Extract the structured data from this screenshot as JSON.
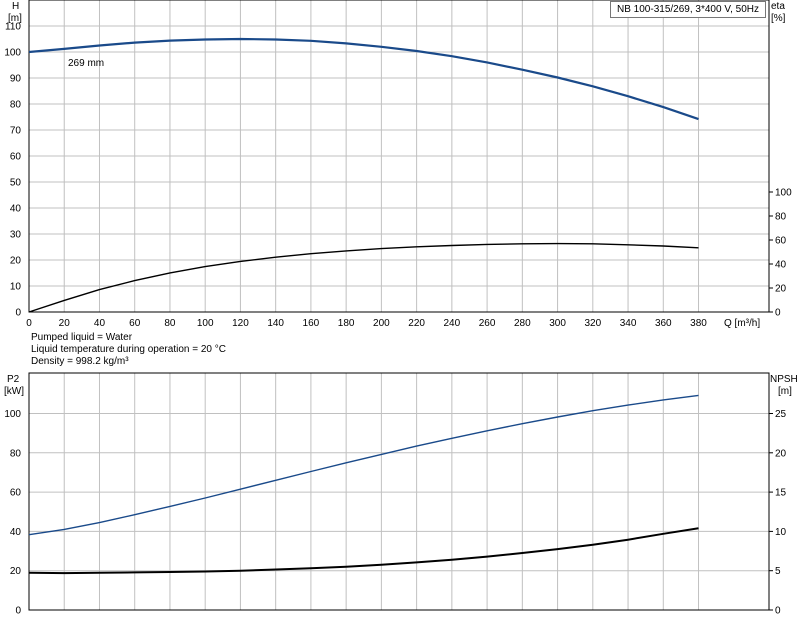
{
  "pump_label": "NB 100-315/269, 3*400 V, 50Hz",
  "liquid_info": {
    "line1": "Pumped liquid = Water",
    "line2": "Liquid temperature during operation = 20 °C",
    "line3": "Density = 998.2 kg/m³"
  },
  "colors": {
    "head": "#1a4a8a",
    "eta": "#000000",
    "p2": "#1a4a8a",
    "npsh": "#000000",
    "grid": "#c0c0c0"
  },
  "chart_data": [
    {
      "type": "line",
      "title": "",
      "x_axis": {
        "label": "Q [m³/h]",
        "range": [
          0,
          420
        ],
        "ticks": [
          0,
          20,
          40,
          60,
          80,
          100,
          120,
          140,
          160,
          180,
          200,
          220,
          240,
          260,
          280,
          300,
          320,
          340,
          360,
          380
        ]
      },
      "y_left": {
        "label_line1": "H",
        "label_line2": "[m]",
        "range": [
          0,
          120
        ],
        "ticks": [
          0,
          10,
          20,
          30,
          40,
          50,
          60,
          70,
          80,
          90,
          100,
          110
        ]
      },
      "y_right": {
        "label_line1": "eta",
        "label_line2": "[%]",
        "range": [
          0,
          100
        ],
        "ticks": [
          0,
          20,
          40,
          60,
          80,
          100
        ]
      },
      "grid": true,
      "series": [
        {
          "name": "269 mm",
          "axis": "left",
          "x": [
            0,
            20,
            40,
            60,
            80,
            100,
            120,
            140,
            160,
            180,
            200,
            220,
            240,
            260,
            280,
            300,
            320,
            340,
            360,
            380
          ],
          "y": [
            100,
            101.2,
            102.5,
            103.6,
            104.4,
            104.8,
            105,
            104.8,
            104.3,
            103.3,
            102,
            100.4,
            98.4,
            96,
            93.2,
            90.2,
            86.8,
            83,
            78.8,
            74.2
          ]
        },
        {
          "axis": "right",
          "x": [
            0,
            20,
            40,
            60,
            80,
            100,
            120,
            140,
            160,
            180,
            200,
            220,
            240,
            260,
            280,
            300,
            320,
            340,
            360,
            380
          ],
          "y": [
            0,
            9.7,
            18.7,
            26.2,
            32.6,
            37.8,
            42.2,
            45.7,
            48.6,
            50.9,
            52.8,
            54.3,
            55.4,
            56.3,
            56.8,
            57.0,
            56.8,
            56.0,
            55.0,
            53.5
          ]
        }
      ]
    },
    {
      "type": "line",
      "title": "",
      "x_axis": {
        "range": [
          0,
          420
        ]
      },
      "y_left": {
        "label_line1": "P2",
        "label_line2": "[kW]",
        "range": [
          0,
          120
        ],
        "ticks": [
          0,
          20,
          40,
          60,
          80,
          100
        ]
      },
      "y_right": {
        "label_line1": "NPSH",
        "label_line2": "[m]",
        "range": [
          0,
          30
        ],
        "ticks": [
          0,
          5,
          10,
          15,
          20,
          25
        ]
      },
      "grid": true,
      "series": [
        {
          "axis": "left",
          "x": [
            0,
            20,
            40,
            60,
            80,
            100,
            120,
            140,
            160,
            180,
            200,
            220,
            240,
            260,
            280,
            300,
            320,
            340,
            360,
            380
          ],
          "y": [
            38.3,
            41,
            44.5,
            48.5,
            52.7,
            57,
            61.5,
            66,
            70.5,
            74.9,
            79.2,
            83.4,
            87.4,
            91.2,
            94.8,
            98.2,
            101.4,
            104.3,
            106.9,
            109.2
          ]
        },
        {
          "axis": "right",
          "x": [
            0,
            20,
            40,
            60,
            80,
            100,
            120,
            140,
            160,
            180,
            200,
            220,
            240,
            260,
            280,
            300,
            320,
            340,
            360,
            380
          ],
          "y": [
            4.75,
            4.7,
            4.73,
            4.78,
            4.83,
            4.9,
            5.0,
            5.15,
            5.3,
            5.5,
            5.75,
            6.05,
            6.4,
            6.8,
            7.25,
            7.75,
            8.3,
            8.95,
            9.7,
            10.4
          ]
        }
      ]
    }
  ]
}
